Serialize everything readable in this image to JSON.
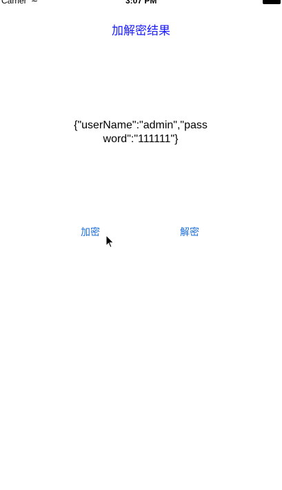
{
  "status_bar": {
    "carrier": "Carrier",
    "wifi_icon": "wifi-icon",
    "time": "3:07 PM",
    "battery_icon": "battery-icon"
  },
  "nav": {
    "title": "加解密结果"
  },
  "main": {
    "result_text": "{\"userName\":\"admin\",\"password\":\"111111\"}",
    "encrypt_label": "加密",
    "decrypt_label": "解密"
  },
  "colors": {
    "title": "#1a1aff",
    "button": "#1e6fd9"
  }
}
